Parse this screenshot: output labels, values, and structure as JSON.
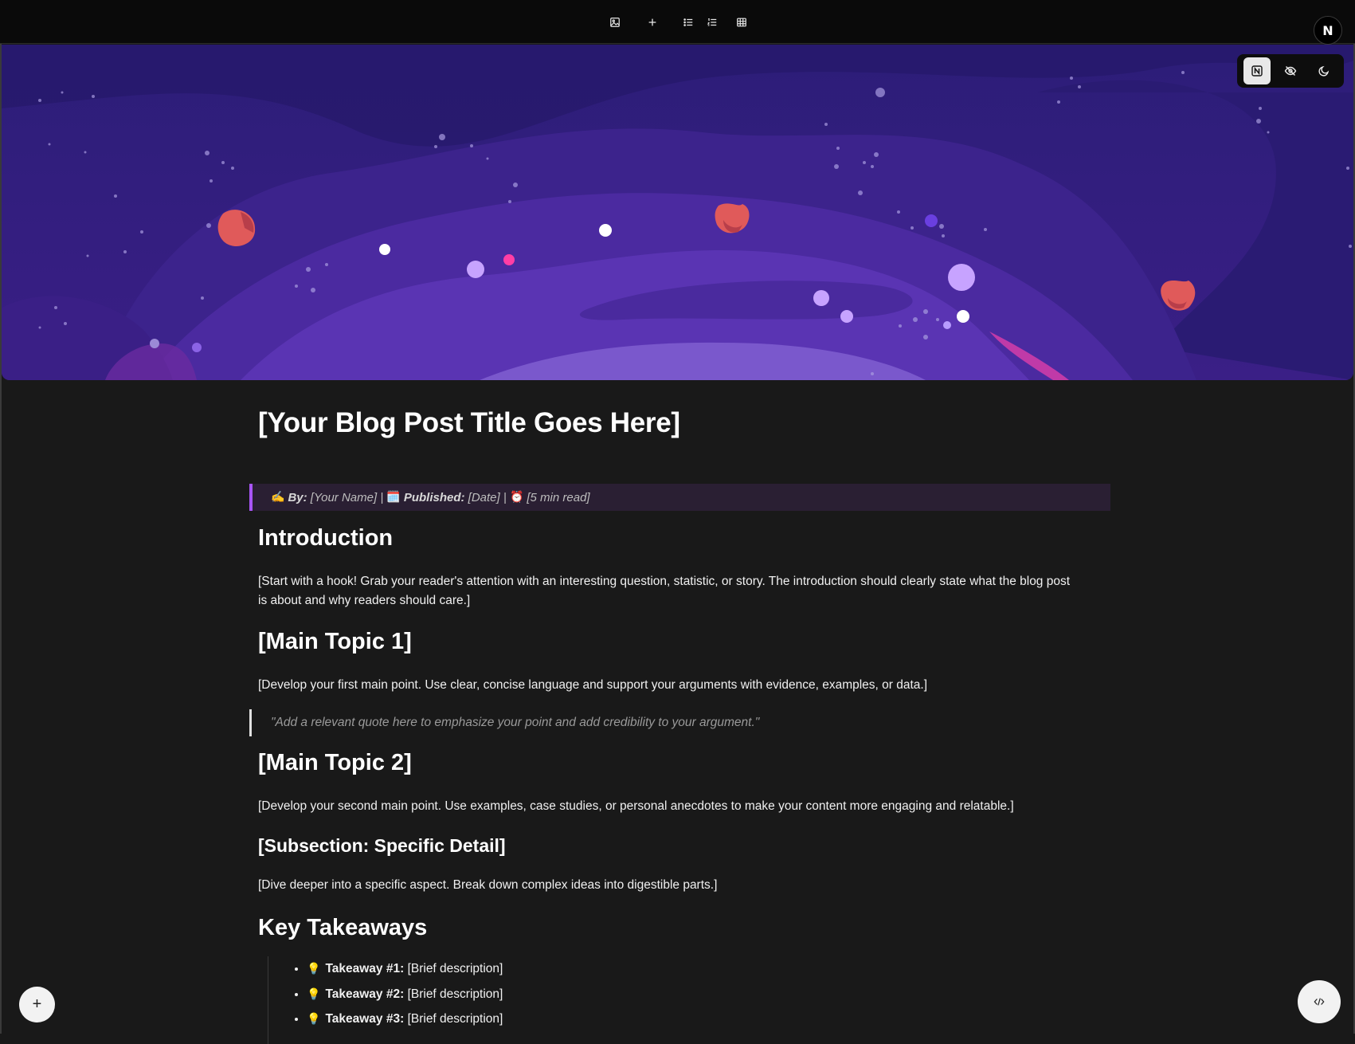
{
  "toolbar": {
    "icons": [
      "image-icon",
      "plus-icon",
      "bullet-list-icon",
      "numbered-list-icon",
      "table-icon"
    ]
  },
  "user": {
    "avatar_letter": "N"
  },
  "banner_controls": [
    "notion-logo-icon",
    "eye-off-icon",
    "moon-icon"
  ],
  "article": {
    "title": "[Your Blog Post Title Goes Here]",
    "meta": {
      "by_emoji": "✍️",
      "by_label": "By:",
      "by_value": "[Your Name] |",
      "published_emoji": "🗓️",
      "published_label": "Published:",
      "published_value": "[Date] |",
      "read_emoji": "⏰",
      "read_value": "[5 min read]"
    },
    "intro_heading": "Introduction",
    "intro_text": "[Start with a hook! Grab your reader's attention with an interesting question, statistic, or story. The introduction should clearly state what the blog post is about and why readers should care.]",
    "topic1_heading": "[Main Topic 1]",
    "topic1_text": "[Develop your first main point. Use clear, concise language and support your arguments with evidence, examples, or data.]",
    "quote": "\"Add a relevant quote here to emphasize your point and add credibility to your argument.\"",
    "topic2_heading": "[Main Topic 2]",
    "topic2_text": "[Develop your second main point. Use examples, case studies, or personal anecdotes to make your content more engaging and relatable.]",
    "subsection_heading": "[Subsection: Specific Detail]",
    "subsection_text": "[Dive deeper into a specific aspect. Break down complex ideas into digestible parts.]",
    "takeaways_heading": "Key Takeaways",
    "takeaways": [
      {
        "label": "Takeaway #1:",
        "text": "[Brief description]"
      },
      {
        "label": "Takeaway #2:",
        "text": "[Brief description]"
      },
      {
        "label": "Takeaway #3:",
        "text": "[Brief description]"
      }
    ]
  },
  "fabs": {
    "left": "+",
    "right_icon": "code-icon"
  },
  "colors": {
    "accent": "#a855f7",
    "background": "#191919",
    "meta_bg": "#2a1f33"
  }
}
